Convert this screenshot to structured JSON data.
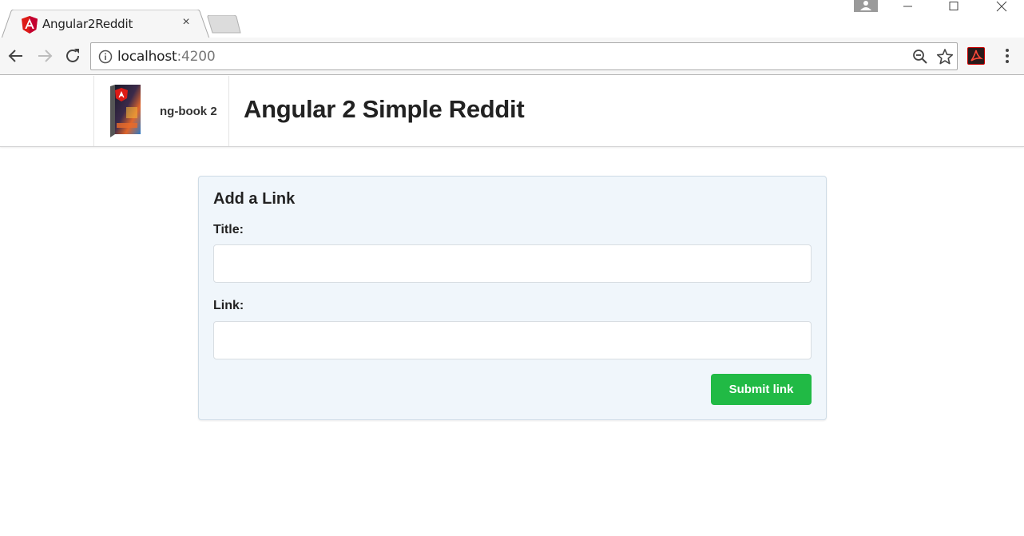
{
  "browser": {
    "tab": {
      "title": "Angular2Reddit",
      "close_glyph": "×",
      "favicon": "angular-icon"
    },
    "address_bar": {
      "host": "localhost",
      "port": ":4200"
    },
    "colors": {
      "angular_red": "#dd1b16",
      "acrobat_red": "#cc0000"
    }
  },
  "site": {
    "brand_label": "ng-book 2",
    "title": "Angular 2 Simple Reddit"
  },
  "form": {
    "heading": "Add a Link",
    "title_label": "Title:",
    "title_value": "",
    "link_label": "Link:",
    "link_value": "",
    "submit_label": "Submit link",
    "colors": {
      "submit_bg": "#21ba45",
      "card_bg": "#f0f6fb"
    }
  }
}
